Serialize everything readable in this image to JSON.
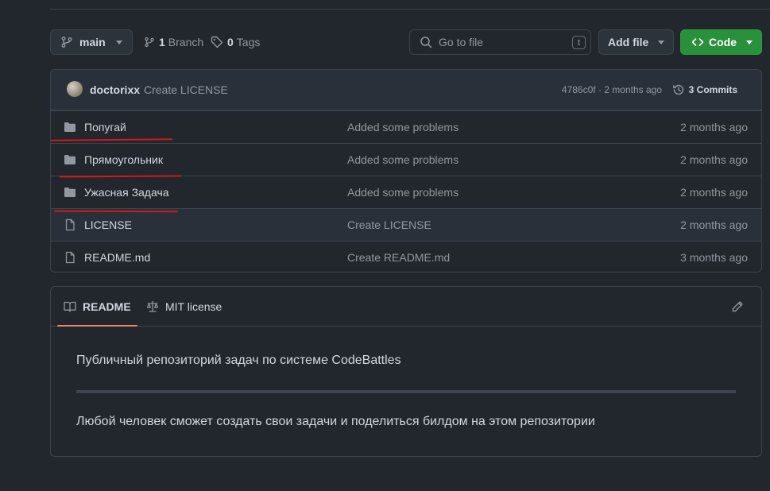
{
  "toolbar": {
    "branch": "main",
    "branch_count": "1",
    "branch_label": "Branch",
    "tag_count": "0",
    "tag_label": "Tags",
    "search_placeholder": "Go to file",
    "search_shortcut": "t",
    "add_file": "Add file",
    "code": "Code"
  },
  "commit": {
    "author": "doctorixx",
    "message": "Create LICENSE",
    "hash_time": "4786c0f · 2 months ago",
    "commits_count": "3",
    "commits_label": "Commits"
  },
  "files": [
    {
      "name": "Попугай",
      "type": "folder",
      "message": "Added some problems",
      "date": "2 months ago"
    },
    {
      "name": "Прямоугольник",
      "type": "folder",
      "message": "Added some problems",
      "date": "2 months ago"
    },
    {
      "name": "Ужасная Задача",
      "type": "folder",
      "message": "Added some problems",
      "date": "2 months ago"
    },
    {
      "name": "LICENSE",
      "type": "file",
      "message": "Create LICENSE",
      "date": "2 months ago"
    },
    {
      "name": "README.md",
      "type": "file",
      "message": "Create README.md",
      "date": "3 months ago"
    }
  ],
  "readme": {
    "tab_readme": "README",
    "tab_license": "MIT license",
    "paragraph1": "Публичный репозиторий задач по системе CodeBattles",
    "paragraph2": "Любой человек сможет создать свои задачи и поделиться билдом на этом репозитории"
  },
  "colors": {
    "background": "#22262d",
    "accent_green": "#29903b",
    "tab_underline": "#f78166",
    "annotation_red": "#d11a1a"
  }
}
